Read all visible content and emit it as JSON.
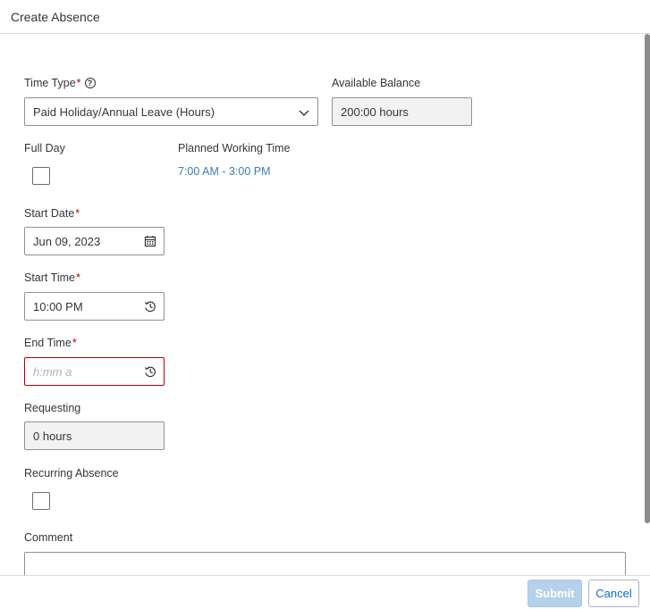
{
  "dialog": {
    "title": "Create Absence"
  },
  "form": {
    "time_type": {
      "label": "Time Type",
      "required_mark": "*",
      "help_icon": "question-circle-icon",
      "value": "Paid Holiday/Annual Leave (Hours)"
    },
    "available_balance": {
      "label": "Available Balance",
      "value": "200:00 hours"
    },
    "full_day": {
      "label": "Full Day",
      "checked": false
    },
    "planned_working_time": {
      "label": "Planned Working Time",
      "value": "7:00 AM - 3:00 PM"
    },
    "start_date": {
      "label": "Start Date",
      "required_mark": "*",
      "value": "Jun 09, 2023",
      "icon": "calendar-icon"
    },
    "start_time": {
      "label": "Start Time",
      "required_mark": "*",
      "value": "10:00 PM",
      "icon": "time-icon"
    },
    "end_time": {
      "label": "End Time",
      "required_mark": "*",
      "value": "",
      "placeholder": "h:mm a",
      "icon": "time-icon"
    },
    "requesting": {
      "label": "Requesting",
      "value": "0 hours"
    },
    "recurring_absence": {
      "label": "Recurring Absence",
      "checked": false
    },
    "comment": {
      "label": "Comment",
      "value": ""
    }
  },
  "footer": {
    "submit_label": "Submit",
    "cancel_label": "Cancel"
  },
  "colors": {
    "required": "#bb0000",
    "link": "#427cac",
    "accent": "#0a6ed1",
    "submit_disabled": "#b5d1ea"
  }
}
